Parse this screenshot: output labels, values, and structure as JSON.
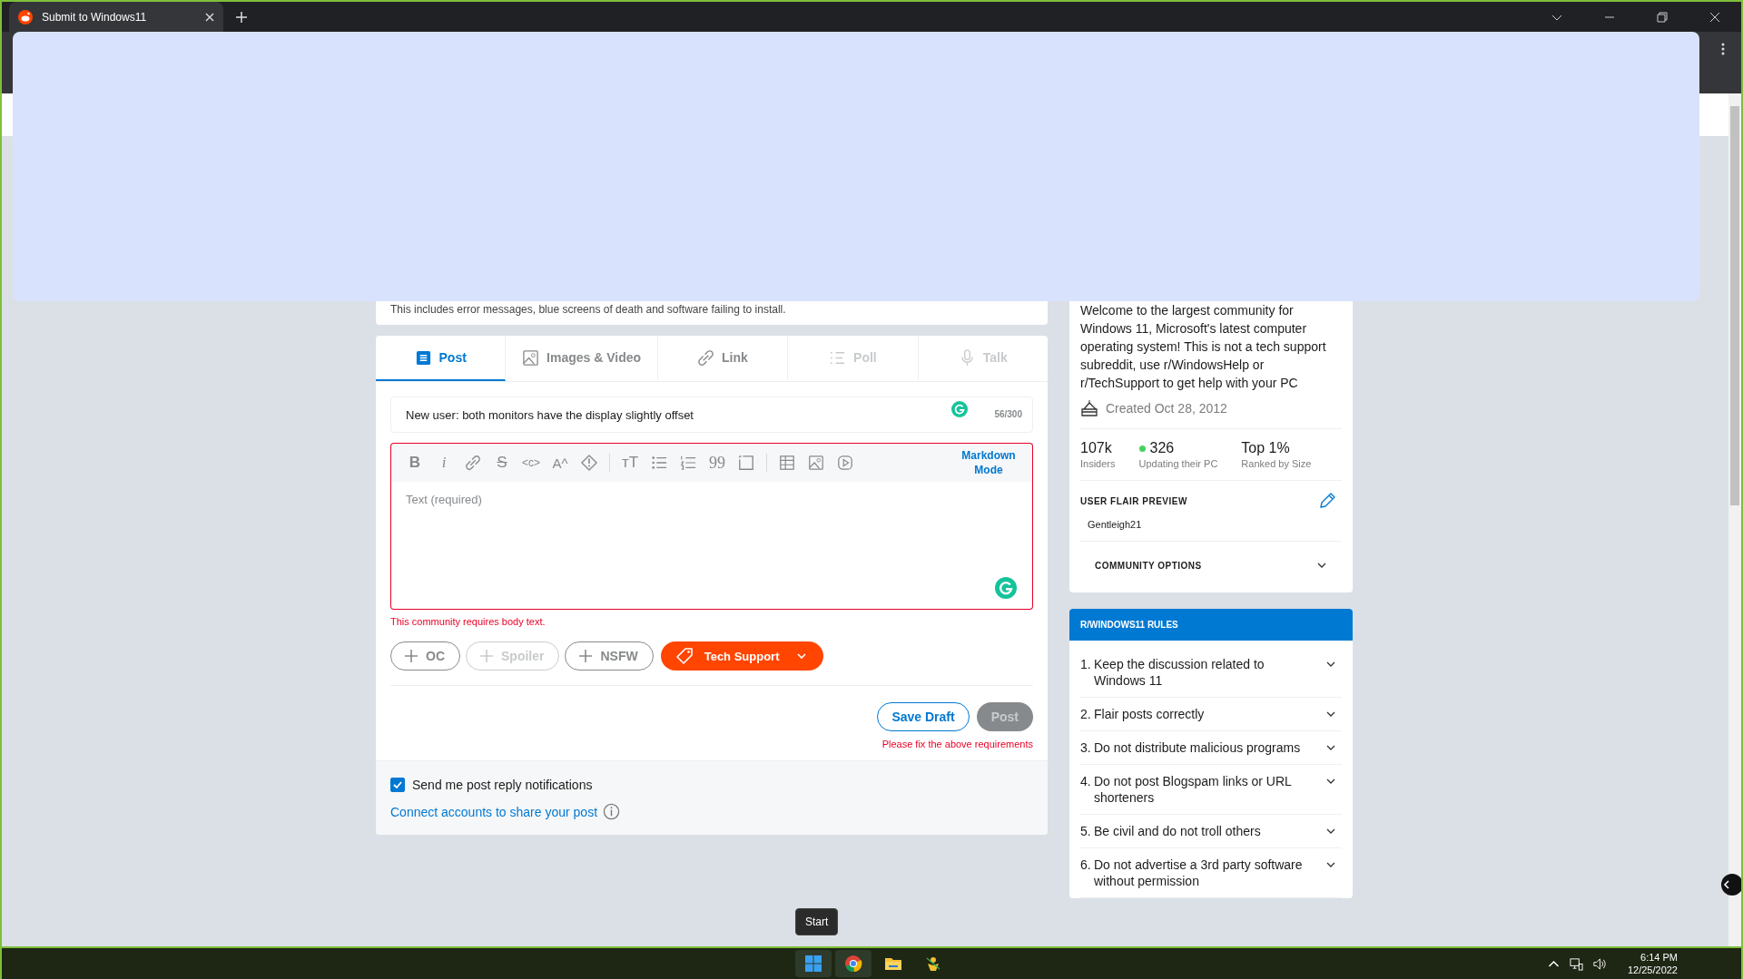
{
  "browser": {
    "tabs": [
      {
        "title": "Submit to Windows11",
        "selected": true
      }
    ]
  },
  "community_note": "This includes error messages, blue screens of death and software failing to install.",
  "post_types": [
    {
      "label": "Post",
      "selected": true,
      "disabled": false
    },
    {
      "label": "Images & Video",
      "selected": false,
      "disabled": false
    },
    {
      "label": "Link",
      "selected": false,
      "disabled": false
    },
    {
      "label": "Poll",
      "selected": false,
      "disabled": true
    },
    {
      "label": "Talk",
      "selected": false,
      "disabled": true
    }
  ],
  "title_field": {
    "value": "New user: both monitors have the display slightly offset",
    "counter": "56/300"
  },
  "editor": {
    "toolbar": [
      [
        {
          "kind": "bold",
          "text": "B"
        },
        {
          "kind": "italic",
          "text": "i"
        },
        {
          "kind": "link"
        },
        {
          "kind": "strike",
          "text": "S"
        },
        {
          "kind": "code",
          "text": "<c>"
        },
        {
          "kind": "super",
          "text": "A^"
        },
        {
          "kind": "spoiler"
        }
      ],
      [
        {
          "kind": "heading",
          "text": "тT"
        },
        {
          "kind": "bullets"
        },
        {
          "kind": "numbers"
        },
        {
          "kind": "quote",
          "text": "99"
        },
        {
          "kind": "codeblock"
        }
      ],
      [
        {
          "kind": "table"
        },
        {
          "kind": "image"
        },
        {
          "kind": "video"
        }
      ]
    ],
    "mode_button": "Markdown Mode",
    "placeholder": "Text (required)",
    "error": "This community requires body text."
  },
  "flair_buttons": [
    {
      "kind": "toggle",
      "label": "OC",
      "disabled": false
    },
    {
      "kind": "toggle",
      "label": "Spoiler",
      "disabled": true
    },
    {
      "kind": "toggle",
      "label": "NSFW",
      "disabled": false
    },
    {
      "kind": "flair",
      "label": "Tech Support",
      "disabled": false
    }
  ],
  "actions": {
    "save_draft": "Save Draft",
    "post": "Post",
    "post_disabled": true,
    "error": "Please fix the above requirements"
  },
  "notifications": {
    "label": "Send me post reply notifications",
    "checked": true
  },
  "connect_link": "Connect accounts to share your post",
  "about": {
    "description": "Welcome to the largest community for Windows 11, Microsoft's latest computer operating system! This is not a tech support subreddit, use r/WindowsHelp or r/TechSupport to get help with your PC",
    "created": "Created Oct 28, 2012",
    "stats": [
      {
        "value": "107k",
        "label": "Insiders"
      },
      {
        "value": "326",
        "label": "Updating their PC",
        "online": true
      },
      {
        "value": "Top 1%",
        "label": "Ranked by Size"
      }
    ],
    "flair_heading": "USER FLAIR PREVIEW",
    "flair": "Gentleigh21",
    "options": {
      "label": "COMMUNITY OPTIONS",
      "expanded": false
    }
  },
  "rules": {
    "title": "R/WINDOWS11 RULES",
    "items": [
      {
        "number": "1.",
        "text": "Keep the discussion related to Windows 11",
        "expanded": false
      },
      {
        "number": "2.",
        "text": "Flair posts correctly",
        "expanded": false
      },
      {
        "number": "3.",
        "text": "Do not distribute malicious programs",
        "expanded": false
      },
      {
        "number": "4.",
        "text": "Do not post Blogspam links or URL shorteners",
        "expanded": false
      },
      {
        "number": "5.",
        "text": "Be civil and do not troll others",
        "expanded": false
      },
      {
        "number": "6.",
        "text": "Do not advertise a 3rd party software without permission",
        "expanded": false
      }
    ]
  },
  "tooltip": "Start",
  "taskbar": {
    "apps": [
      {
        "kind": "start",
        "highlighted": true
      },
      {
        "kind": "browser",
        "highlighted": true
      },
      {
        "kind": "folder",
        "highlighted": false
      },
      {
        "kind": "app",
        "highlighted": false
      }
    ],
    "time": "6:14 PM",
    "date": "12/25/2022"
  }
}
